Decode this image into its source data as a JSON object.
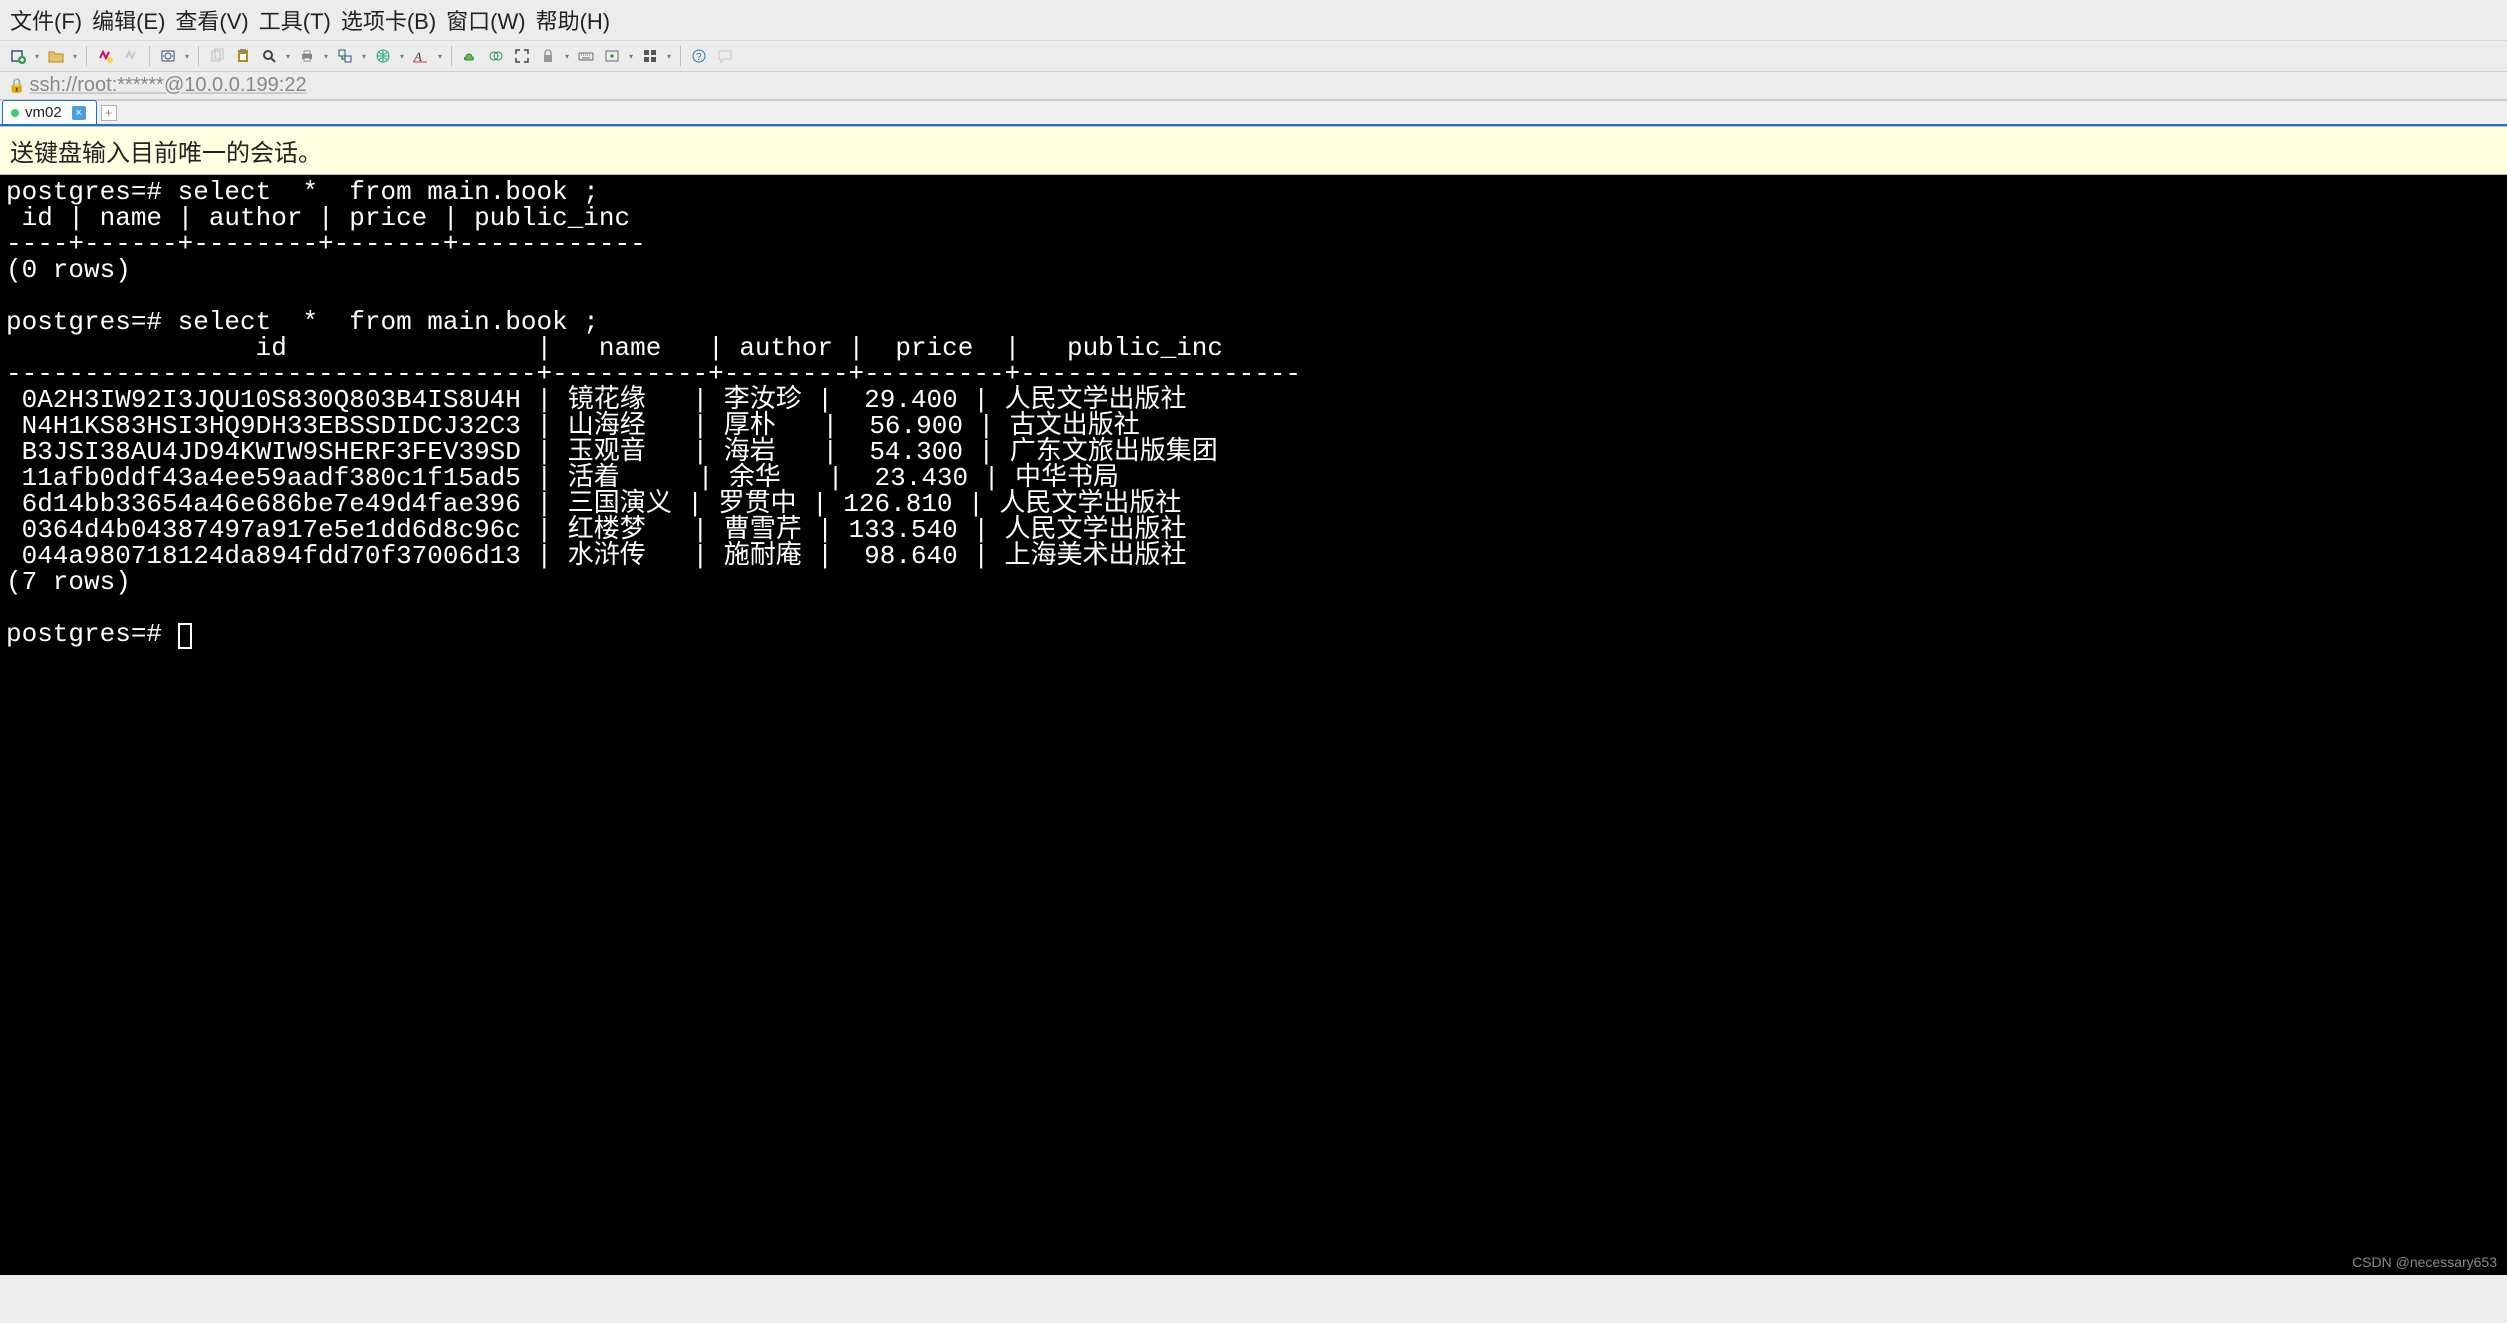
{
  "menubar": {
    "file": "文件(F)",
    "edit": "编辑(E)",
    "view": "查看(V)",
    "tools": "工具(T)",
    "tabs": "选项卡(B)",
    "window": "窗口(W)",
    "help": "帮助(H)"
  },
  "address": {
    "lock_icon": "🔒",
    "text": "ssh://root:******@10.0.0.199:22"
  },
  "tabs": {
    "active": "vm02"
  },
  "infobar": {
    "message": "送键盘输入目前唯一的会话。"
  },
  "terminal": {
    "prompt": "postgres=#",
    "query1": "select  *  from main.book ;",
    "header1": " id | name | author | price | public_inc",
    "sep1": "----+------+--------+-------+------------",
    "rows1_footer": "(0 rows)",
    "query2": "select  *  from main.book ;",
    "header2": "                id                |   name   | author |  price  |   public_inc",
    "sep2": "----------------------------------+----------+--------+---------+------------------",
    "data2": [
      {
        "id": "0A2H3IW92I3JQU10S830Q803B4IS8U4H",
        "name": "镜花缘",
        "author": "李汝珍",
        "price": "29.400",
        "public_inc": "人民文学出版社"
      },
      {
        "id": "N4H1KS83HSI3HQ9DH33EBSSDIDCJ32C3",
        "name": "山海经",
        "author": "厚朴",
        "price": "56.900",
        "public_inc": "古文出版社"
      },
      {
        "id": "B3JSI38AU4JD94KWIW9SHERF3FEV39SD",
        "name": "玉观音",
        "author": "海岩",
        "price": "54.300",
        "public_inc": "广东文旅出版集团"
      },
      {
        "id": "11afb0ddf43a4ee59aadf380c1f15ad5",
        "name": "活着",
        "author": "余华",
        "price": "23.430",
        "public_inc": "中华书局"
      },
      {
        "id": "6d14bb33654a46e686be7e49d4fae396",
        "name": "三国演义",
        "author": "罗贯中",
        "price": "126.810",
        "public_inc": "人民文学出版社"
      },
      {
        "id": "0364d4b04387497a917e5e1dd6d8c96c",
        "name": "红楼梦",
        "author": "曹雪芹",
        "price": "133.540",
        "public_inc": "人民文学出版社"
      },
      {
        "id": "044a980718124da894fdd70f37006d13",
        "name": "水浒传",
        "author": "施耐庵",
        "price": "98.640",
        "public_inc": "上海美术出版社"
      }
    ],
    "rows2_footer": "(7 rows)"
  },
  "watermark": "CSDN @necessary653"
}
